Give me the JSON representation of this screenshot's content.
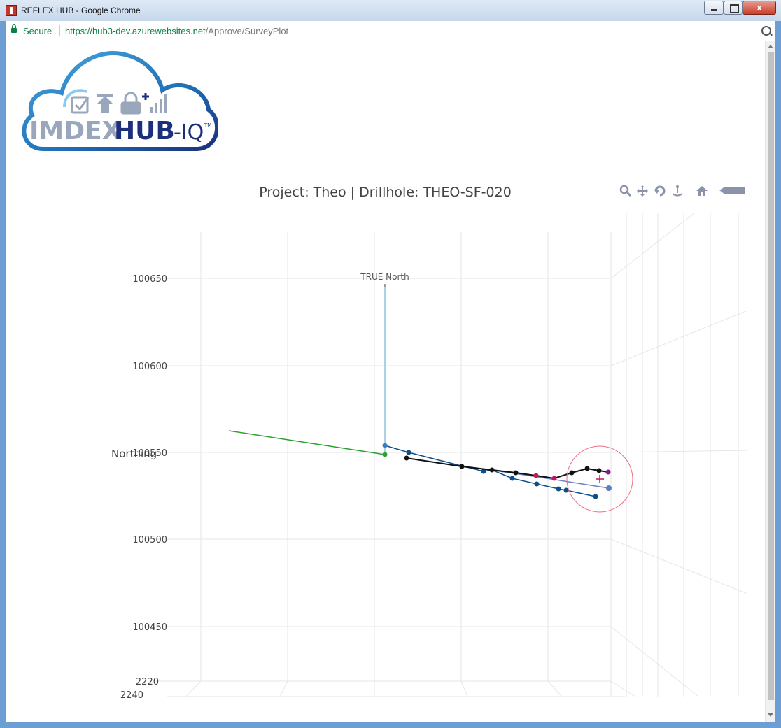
{
  "window": {
    "title": "REFLEX HUB - Google Chrome",
    "close_glyph": "x"
  },
  "addressbar": {
    "secure_label": "Secure",
    "url_host": "https://hub3-dev.azurewebsites.net",
    "url_path": "/Approve/SurveyPlot"
  },
  "logo": {
    "text_left": "IMDEX",
    "text_right": "HUB",
    "text_suffix": "-IQ",
    "trademark": "TM"
  },
  "plot": {
    "title": "Project: Theo | Drillhole: THEO-SF-020",
    "modebar": [
      "zoom-icon",
      "pan-icon",
      "orbit-icon",
      "turntable-icon",
      "reset-camera-icon",
      "toggle-spikelines-icon"
    ]
  },
  "chart_data": {
    "type": "scatter",
    "title": "Project: Theo | Drillhole: THEO-SF-020",
    "ylabel": "Northing",
    "y_ticks": [
      100650,
      100600,
      100550,
      100500,
      100450
    ],
    "z_ticks": [
      2220,
      2240
    ],
    "annotation": "TRUE North",
    "colors": {
      "true_north": "#a9d3e3",
      "planned": "#2ca02c",
      "survey_a": "#0b4f8a",
      "survey_b": "#111111",
      "survey_c": "#6a7fc4",
      "outlier": "#c2185b",
      "target": "#f06c83"
    }
  }
}
